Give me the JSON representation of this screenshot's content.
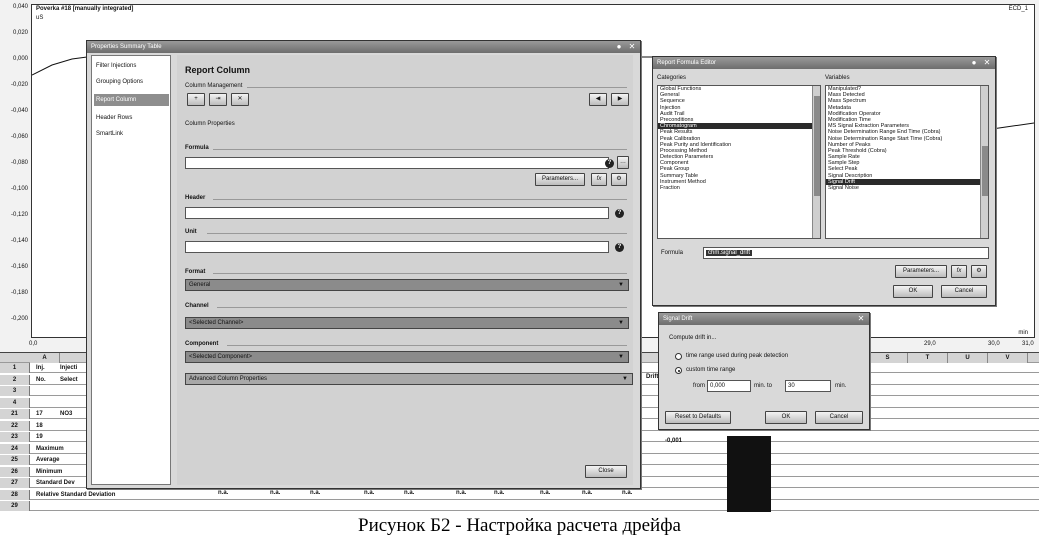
{
  "chromatogram": {
    "title": "Poverka #18 [manually integrated]",
    "channel": "ECD_1",
    "sub": "uS",
    "y_ticks": [
      "0,040",
      "0,020",
      "0,000",
      "-0,020",
      "-0,040",
      "-0,060",
      "-0,080",
      "-0,100",
      "-0,120",
      "-0,140",
      "-0,160",
      "-0,180",
      "-0,200"
    ],
    "x_ticks": [
      "0,0",
      "29,0",
      "30,0",
      "31,0"
    ],
    "x_unit": "min"
  },
  "sheet": {
    "col_a": "A",
    "col_right": [
      "S",
      "T",
      "U",
      "V"
    ],
    "rows": [
      {
        "n": "1",
        "a": "Inj.",
        "b": "Injecti"
      },
      {
        "n": "2",
        "a": "No.",
        "b": "Select"
      },
      {
        "n": "3",
        "a": "",
        "b": ""
      },
      {
        "n": "4",
        "a": "",
        "b": ""
      },
      {
        "n": "21",
        "a": "17",
        "b": "NO3"
      },
      {
        "n": "22",
        "a": "18",
        "b": ""
      },
      {
        "n": "23",
        "a": "19",
        "b": ""
      },
      {
        "n": "24",
        "a": "Maximum",
        "b": ""
      },
      {
        "n": "25",
        "a": "Average",
        "b": ""
      },
      {
        "n": "26",
        "a": "Minimum",
        "b": ""
      },
      {
        "n": "27",
        "a": "Standard Dev",
        "b": ""
      },
      {
        "n": "28",
        "a": "Relative Standard Deviation",
        "b": ""
      },
      {
        "n": "29",
        "a": "",
        "b": ""
      }
    ],
    "drift_value": "-0,001",
    "na_label": "n.a.",
    "drift_col_header": "Drift"
  },
  "props_window": {
    "title": "Properties Summary Table",
    "nav": [
      "Filter Injections",
      "Grouping Options",
      "Report Column",
      "Header Rows",
      "SmartLink"
    ],
    "heading": "Report Column",
    "column_management": "Column Management",
    "column_properties": "Column Properties",
    "formula_label": "Formula",
    "parameters_btn": "Parameters...",
    "header_label": "Header",
    "unit_label": "Unit",
    "format_label": "Format",
    "format_value": "General",
    "channel_label": "Channel",
    "channel_value": "<Selected Channel>",
    "component_label": "Component",
    "component_value": "<Selected Component>",
    "advanced": "Advanced Column Properties",
    "close_btn": "Close"
  },
  "formula_editor": {
    "title": "Report Formula Editor",
    "categories_label": "Categories",
    "variables_label": "Variables",
    "categories": [
      "Global Functions",
      "General",
      "Sequence",
      "Injection",
      "Audit Trail",
      "Preconditions",
      "Chromatogram",
      "Peak Results",
      "Peak Calibration",
      "Peak Purity and Identification",
      "Processing Method",
      "Detection Parameters",
      "Component",
      "Peak Group",
      "Summary Table",
      "Instrument Method",
      "Fraction"
    ],
    "categories_selected": 6,
    "variables": [
      "Manipulated?",
      "Mass Detected",
      "Mass Spectrum",
      "Metadata",
      "Modification Operator",
      "Modification Time",
      "MS Signal Extraction Parameters",
      "Noise Determination Range End Time (Cobra)",
      "Noise Determination Range Start Time (Cobra)",
      "Number of Peaks",
      "Peak Threshold (Cobra)",
      "Sample Rate",
      "Sample Step",
      "Select Peak",
      "Signal Description",
      "Signal Drift",
      "Signal Noise"
    ],
    "variables_selected": 15,
    "formula_label": "Formula",
    "formula_value": "chm.signal_drift",
    "parameters_btn": "Parameters...",
    "ok_btn": "OK",
    "cancel_btn": "Cancel"
  },
  "drift_dialog": {
    "title": "Signal Drift",
    "prompt": "Compute drift in...",
    "option1": "time range used during peak detection",
    "option2": "custom time range",
    "from_label": "from",
    "from_value": "0,000",
    "to_label": "min. to",
    "to_value": "30",
    "min_label": "min.",
    "reset_btn": "Reset to Defaults",
    "ok_btn": "OK",
    "cancel_btn": "Cancel"
  },
  "caption": "Рисунок Б2 - Настройка расчета дрейфа"
}
